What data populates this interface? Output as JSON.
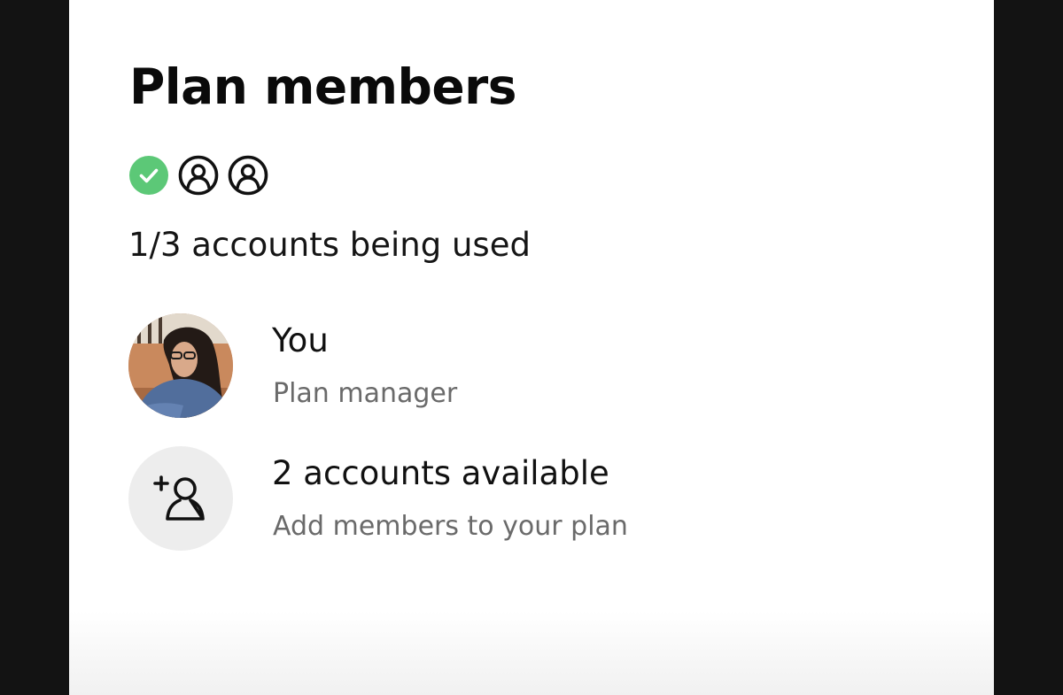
{
  "page": {
    "title": "Plan members",
    "usage_text": "1/3 accounts being used"
  },
  "seats": {
    "total": 3,
    "used": 1,
    "icons": [
      "check-circle-icon",
      "person-outline-icon",
      "person-outline-icon"
    ]
  },
  "members": [
    {
      "name": "You",
      "role": "Plan manager",
      "icon": "avatar-photo"
    }
  ],
  "add_members": {
    "title": "2 accounts available",
    "subtitle": "Add members to your plan",
    "icon": "add-person-icon"
  },
  "colors": {
    "check_green": "#5cc877",
    "text_primary": "#111111",
    "text_secondary": "#6a6a6a",
    "frame_background": "#131313"
  }
}
